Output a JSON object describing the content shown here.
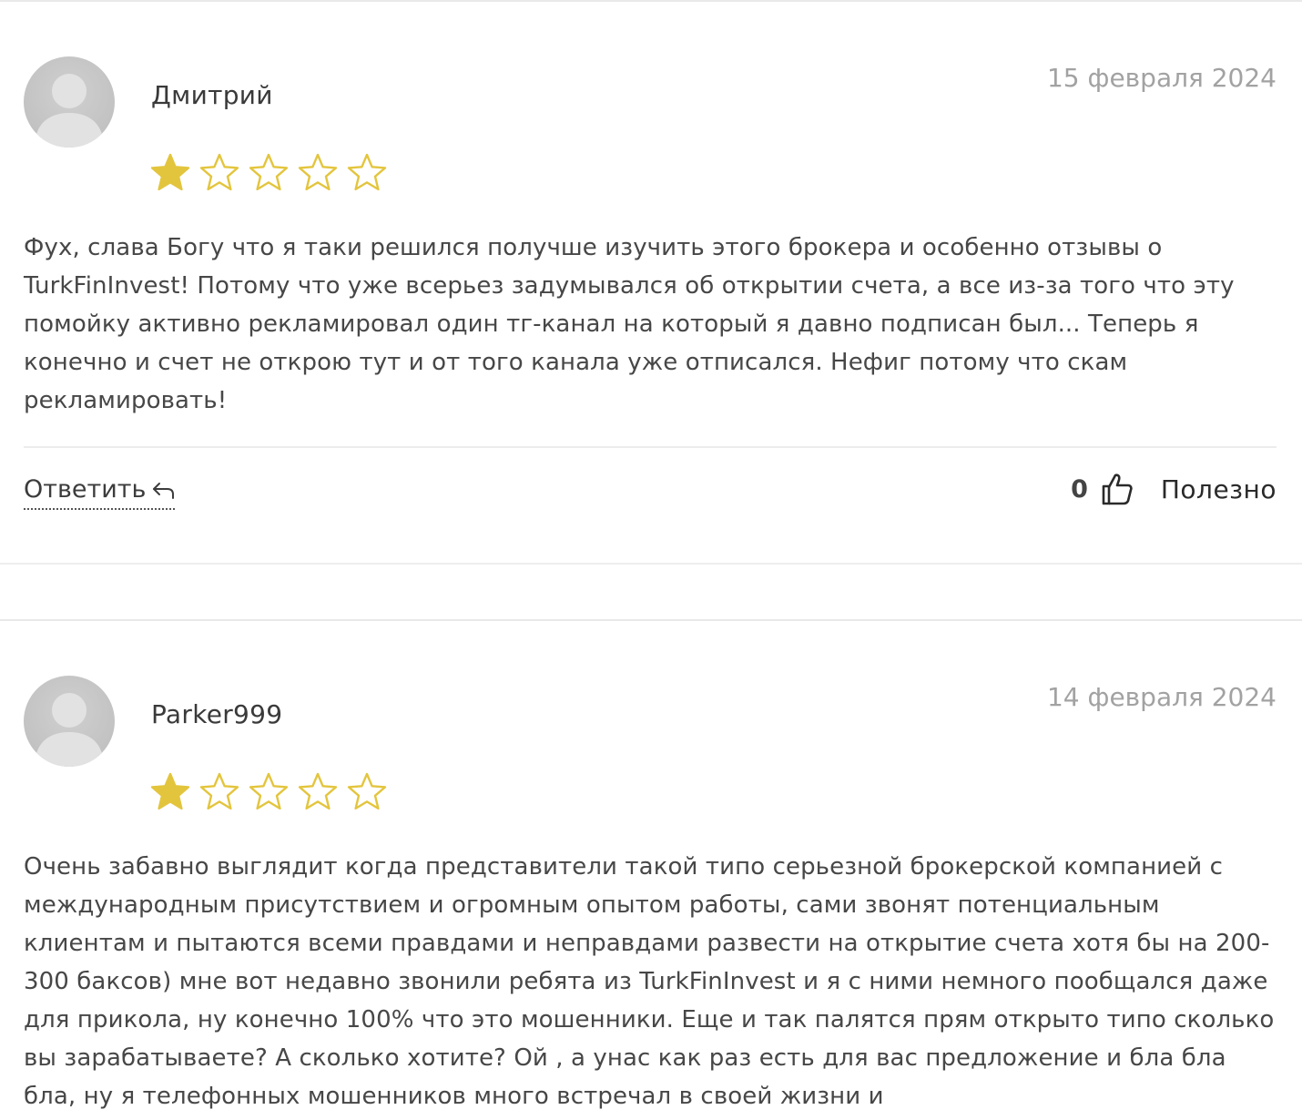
{
  "reviews": [
    {
      "author": "Дмитрий",
      "date": "15 февраля 2024",
      "rating": 1,
      "rating_max": 5,
      "text": "Фух, слава Богу что я таки решился получше изучить этого брокера и особенно отзывы о TurkFinInvest! Потому что уже всерьез задумывался об открытии счета, а все из-за того что эту помойку активно рекламировал один тг-канал на который я давно подписан был... Теперь я конечно и счет не открою тут и от того канала уже отписался. Нефиг потому что скам рекламировать!",
      "reply_label": "Ответить",
      "helpful_count": "0",
      "helpful_label": "Полезно"
    },
    {
      "author": "Parker999",
      "date": "14 февраля 2024",
      "rating": 1,
      "rating_max": 5,
      "text": "Очень забавно выглядит когда представители такой типо серьезной брокерской компанией с международным присутствием и огромным опытом работы, сами звонят потенциальным клиентам и пытаются всеми правдами и неправдами развести на открытие счета хотя бы на 200-300 баксов) мне вот недавно звонили ребята из TurkFinInvest и я с ними немного пообщался даже для прикола, ну конечно 100% что это мошенники. Еще и так палятся прям открыто типо сколько вы зарабатываете? А сколько хотите? Ой , а унас как раз есть для вас предложение и бла бла бла, ну я телефонных мошенников много встречал в своей жизни и"
    }
  ],
  "colors": {
    "star_filled": "#e3c53d",
    "star_outline": "#e3c53d",
    "date": "#a2a2a2",
    "text": "#474747"
  },
  "icons": {
    "avatar": "default-user-avatar-icon",
    "star": "star-icon",
    "reply": "reply-arrow-icon",
    "thumb": "thumbs-up-icon"
  }
}
